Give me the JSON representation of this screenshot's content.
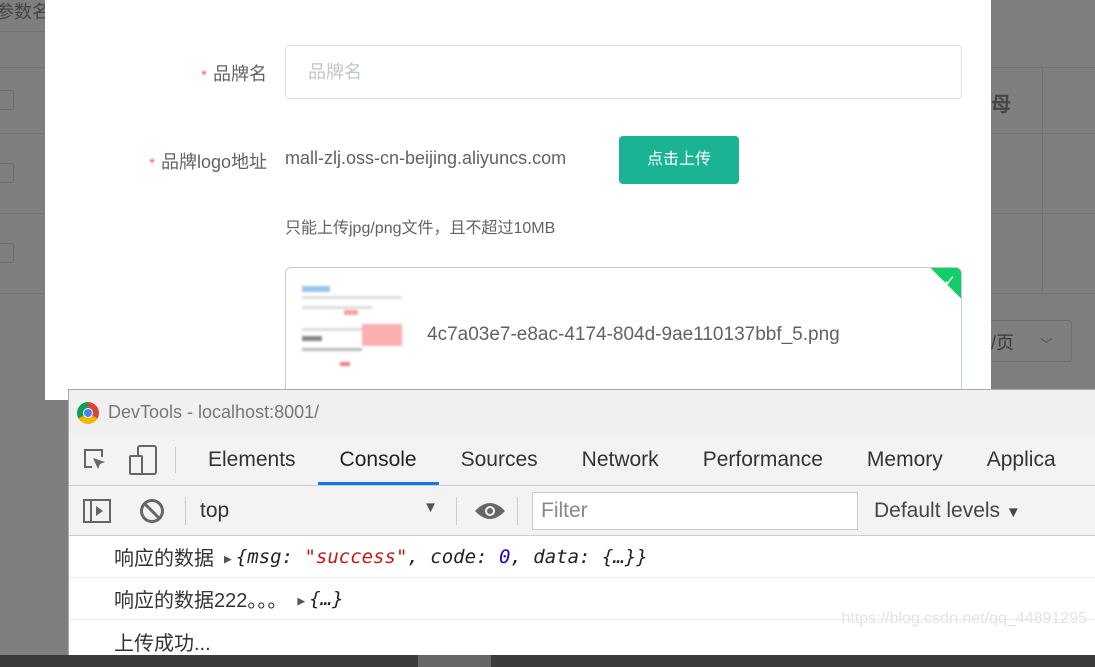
{
  "background": {
    "header_partial": "参数名",
    "header_right": "母",
    "pagination_suffix": "/页"
  },
  "form": {
    "brand_name_label": "品牌名",
    "brand_name_placeholder": "品牌名",
    "logo_label": "品牌logo地址",
    "logo_host": "mall-zlj.oss-cn-beijing.aliyuncs.com",
    "upload_button": "点击上传",
    "upload_tip": "只能上传jpg/png文件，且不超过10MB",
    "file_name": "4c7a03e7-e8ac-4174-804d-9ae110137bbf_5.png",
    "required_mark": "*"
  },
  "devtools": {
    "title": "DevTools - localhost:8001/",
    "tabs": [
      {
        "label": "Elements"
      },
      {
        "label": "Console",
        "active": true
      },
      {
        "label": "Sources"
      },
      {
        "label": "Network"
      },
      {
        "label": "Performance"
      },
      {
        "label": "Memory"
      },
      {
        "label": "Applica"
      }
    ],
    "context": "top",
    "filter_placeholder": "Filter",
    "levels": "Default levels",
    "logs": [
      {
        "prefix": "响应的数据",
        "obj_open": "{msg: ",
        "str": "\"success\"",
        "mid": ", code: ",
        "num": "0",
        "end": ", data: {…}}"
      },
      {
        "prefix": "响应的数据222。。。",
        "obj": "{…}"
      },
      {
        "text": "上传成功..."
      }
    ]
  },
  "watermark": "https://blog.csdn.net/qq_44891295",
  "colors": {
    "primary": "#1ab394",
    "success": "#13ce66",
    "required": "#f56c6c",
    "active_tab": "#1a73e8"
  }
}
